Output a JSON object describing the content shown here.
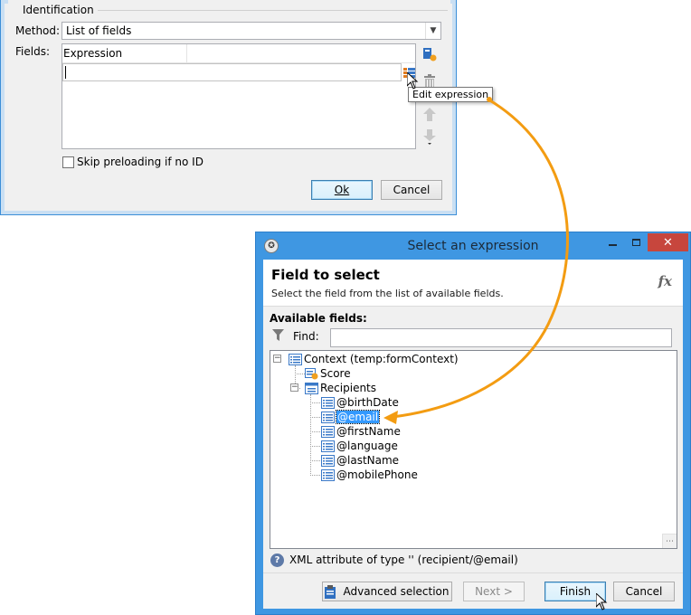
{
  "dialog1": {
    "group_label": "Identification",
    "method_label": "Method:",
    "method_value": "List of fields",
    "fields_label": "Fields:",
    "column_header": "Expression",
    "tooltip": "Edit expression",
    "checkbox_label": "Skip preloading if no ID",
    "ok_label": "Ok",
    "cancel_label": "Cancel"
  },
  "dialog2": {
    "title": "Select an expression",
    "header_title": "Field to select",
    "header_subtitle": "Select the field from the list of available fields.",
    "fx_label": "fx",
    "available_label": "Available fields:",
    "find_label": "Find:",
    "find_value": "",
    "tree": {
      "root": "Context (temp:formContext)",
      "score": "Score",
      "recipients": "Recipients",
      "fields": [
        "@birthDate",
        "@email",
        "@firstName",
        "@language",
        "@lastName",
        "@mobilePhone"
      ],
      "selected": "@email"
    },
    "status_text": "XML attribute of type '' (recipient/@email)",
    "buttons": {
      "advanced": "Advanced selection",
      "next": "Next >",
      "finish": "Finish",
      "cancel": "Cancel"
    }
  },
  "colors": {
    "accent": "#f39c12",
    "titlebar": "#3f97e2",
    "selection": "#3399ff"
  }
}
